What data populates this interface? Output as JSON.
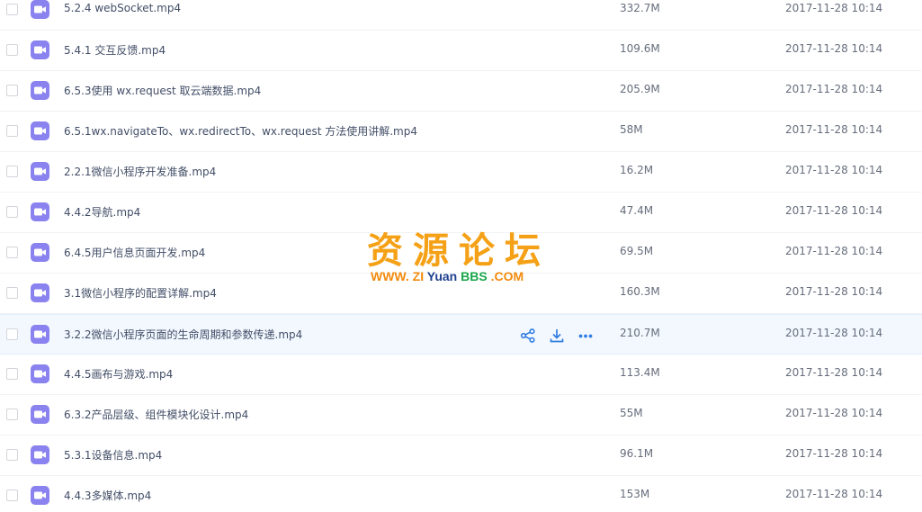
{
  "accent": "#8a82ef",
  "files": [
    {
      "name": "5.2.4 webSocket.mp4",
      "size": "332.7M",
      "date": "2017-11-28 10:14",
      "icon": "video-file-icon"
    },
    {
      "name": "5.4.1 交互反馈.mp4",
      "size": "109.6M",
      "date": "2017-11-28 10:14",
      "icon": "video-file-icon"
    },
    {
      "name": "6.5.3使用 wx.request 取云端数据.mp4",
      "size": "205.9M",
      "date": "2017-11-28 10:14",
      "icon": "video-file-icon"
    },
    {
      "name": "6.5.1wx.navigateTo、wx.redirectTo、wx.request 方法使用讲解.mp4",
      "size": "58M",
      "date": "2017-11-28 10:14",
      "icon": "video-file-icon"
    },
    {
      "name": "2.2.1微信小程序开发准备.mp4",
      "size": "16.2M",
      "date": "2017-11-28 10:14",
      "icon": "video-file-icon"
    },
    {
      "name": "4.4.2导航.mp4",
      "size": "47.4M",
      "date": "2017-11-28 10:14",
      "icon": "video-file-icon"
    },
    {
      "name": "6.4.5用户信息页面开发.mp4",
      "size": "69.5M",
      "date": "2017-11-28 10:14",
      "icon": "video-file-icon"
    },
    {
      "name": "3.1微信小程序的配置详解.mp4",
      "size": "160.3M",
      "date": "2017-11-28 10:14",
      "icon": "video-file-icon"
    },
    {
      "name": "3.2.2微信小程序页面的生命周期和参数传递.mp4",
      "size": "210.7M",
      "date": "2017-11-28 10:14",
      "icon": "video-file-icon"
    },
    {
      "name": "4.4.5画布与游戏.mp4",
      "size": "113.4M",
      "date": "2017-11-28 10:14",
      "icon": "video-file-icon"
    },
    {
      "name": "6.3.2产品层级、组件模块化设计.mp4",
      "size": "55M",
      "date": "2017-11-28 10:14",
      "icon": "video-file-icon"
    },
    {
      "name": "5.3.1设备信息.mp4",
      "size": "96.1M",
      "date": "2017-11-28 10:14",
      "icon": "video-file-icon"
    },
    {
      "name": "4.4.3多媒体.mp4",
      "size": "153M",
      "date": "2017-11-28 10:14",
      "icon": "video-file-icon"
    }
  ],
  "hover_row_actions": [
    "share-icon",
    "download-icon",
    "more-icon"
  ],
  "watermark": {
    "title": "资源论坛",
    "sub_www": "WWW.",
    "sub_zi": "ZI",
    "sub_yuan": "Yuan",
    "sub_bbs": "BBS",
    "sub_com": ".COM"
  }
}
